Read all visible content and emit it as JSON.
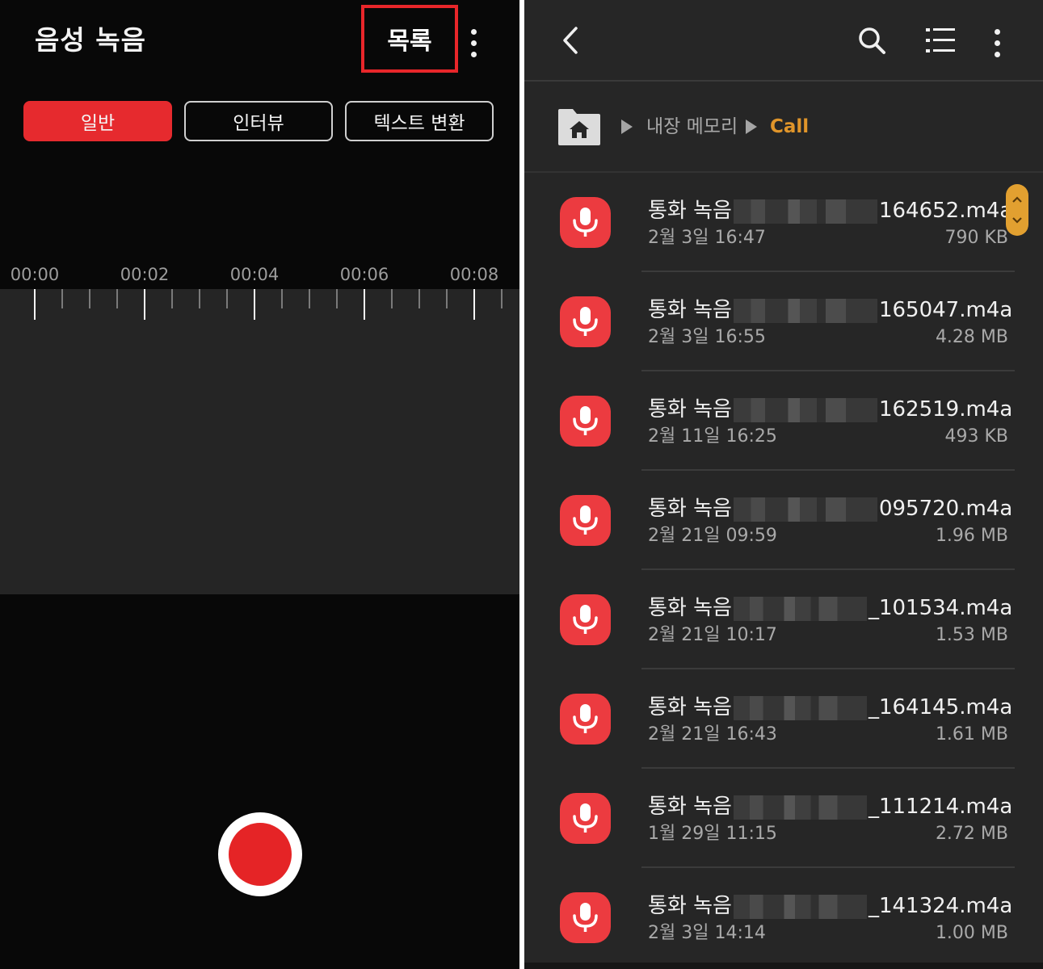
{
  "recorder": {
    "title": "음성 녹음",
    "list_button": "목록",
    "modes": [
      {
        "label": "일반",
        "active": true
      },
      {
        "label": "인터뷰",
        "active": false
      },
      {
        "label": "텍스트 변환",
        "active": false
      }
    ],
    "timeline": [
      "00:00",
      "00:02",
      "00:04",
      "00:06",
      "00:08"
    ],
    "accent_color": "#e62a2e"
  },
  "files": {
    "breadcrumb": {
      "storage": "내장 메모리",
      "current": "Call"
    },
    "accent_color": "#e0952a",
    "items": [
      {
        "prefix": "통화 녹음",
        "suffix": "164652.m4a",
        "date": "2월 3일 16:47",
        "size": "790 KB"
      },
      {
        "prefix": "통화 녹음",
        "suffix": "165047.m4a",
        "date": "2월 3일 16:55",
        "size": "4.28 MB"
      },
      {
        "prefix": "통화 녹음",
        "suffix": "162519.m4a",
        "date": "2월 11일 16:25",
        "size": "493 KB"
      },
      {
        "prefix": "통화 녹음",
        "suffix": "095720.m4a",
        "date": "2월 21일 09:59",
        "size": "1.96 MB"
      },
      {
        "prefix": "통화 녹음",
        "suffix": "_101534.m4a",
        "date": "2월 21일 10:17",
        "size": "1.53 MB"
      },
      {
        "prefix": "통화 녹음",
        "suffix": "_164145.m4a",
        "date": "2월 21일 16:43",
        "size": "1.61 MB"
      },
      {
        "prefix": "통화 녹음",
        "suffix": "_111214.m4a",
        "date": "1월 29일 11:15",
        "size": "2.72 MB"
      },
      {
        "prefix": "통화 녹음",
        "suffix": "_141324.m4a",
        "date": "2월 3일 14:14",
        "size": "1.00 MB"
      }
    ]
  }
}
